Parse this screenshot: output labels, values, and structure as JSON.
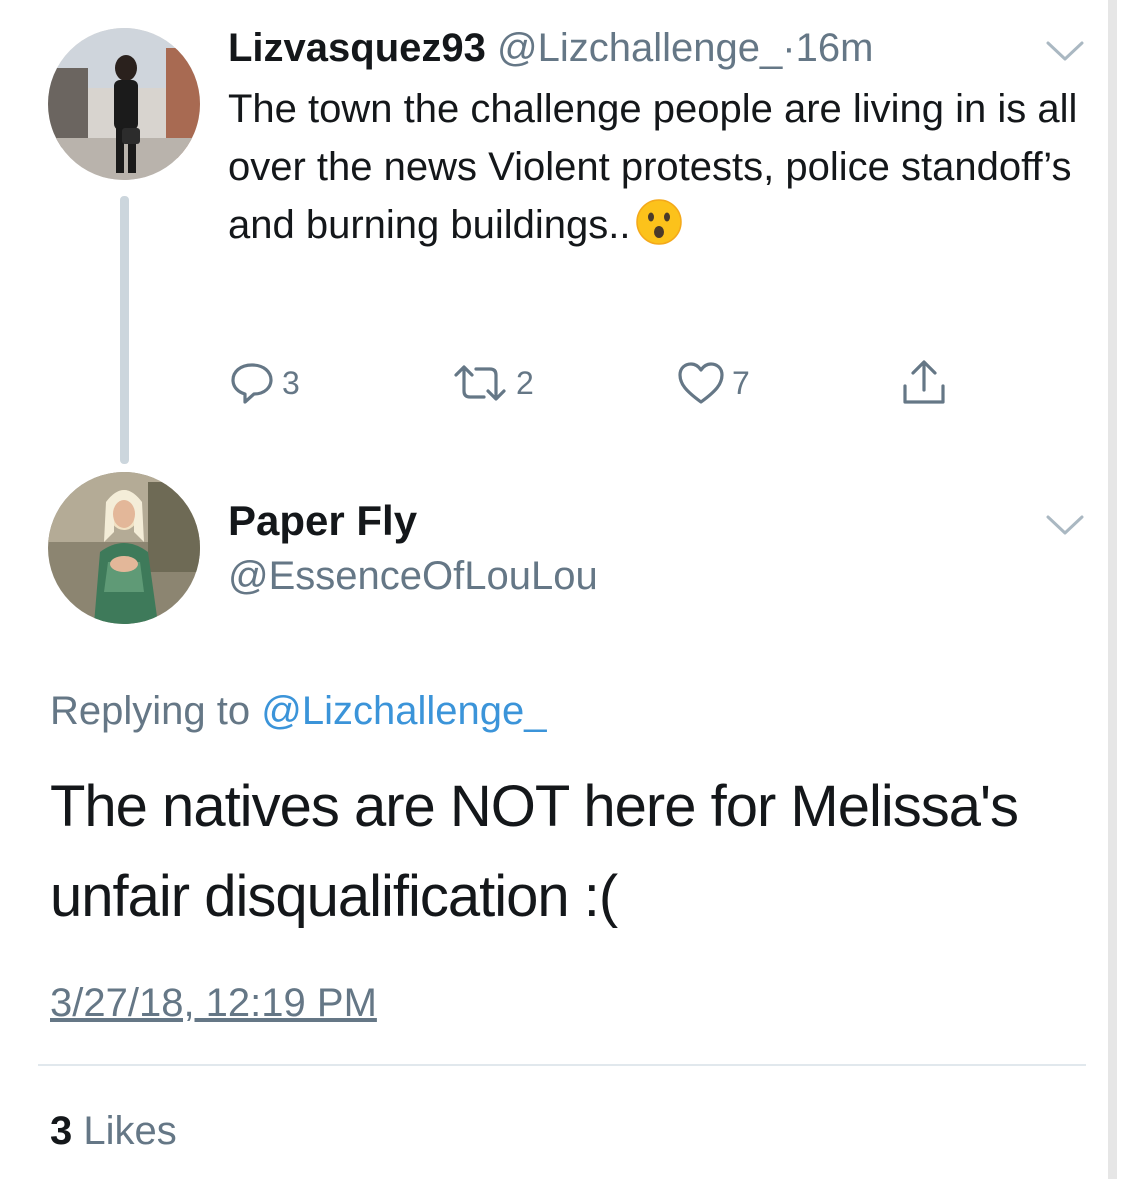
{
  "tweet": {
    "author": {
      "name": "Lizvasquez93",
      "handle": "@Lizchallenge_",
      "avatar": "profile-photo"
    },
    "separator": "·",
    "time": "16m",
    "text": "The town the challenge people are living in is all over the news Violent protests, police standoff’s and burning buildings..",
    "emoji": "hushed-face-emoji",
    "actions": {
      "replies": "3",
      "retweets": "2",
      "likes": "7"
    }
  },
  "reply": {
    "author": {
      "name": "Paper Fly",
      "handle": "@EssenceOfLouLou",
      "avatar": "profile-photo"
    },
    "replying_to_label": "Replying to",
    "replying_to_handle": "@Lizchallenge_",
    "text_line1": "The natives are NOT here for Melissa's",
    "text_line2": "unfair disqualification :(",
    "timestamp": "3/27/18, 12:19 PM",
    "likes_count": "3",
    "likes_label": "Likes"
  },
  "colors": {
    "text_primary": "#14171a",
    "text_secondary": "#657786",
    "link": "#3b94d9",
    "divider": "#e1e8ed",
    "thread_line": "#ccd6dd"
  }
}
